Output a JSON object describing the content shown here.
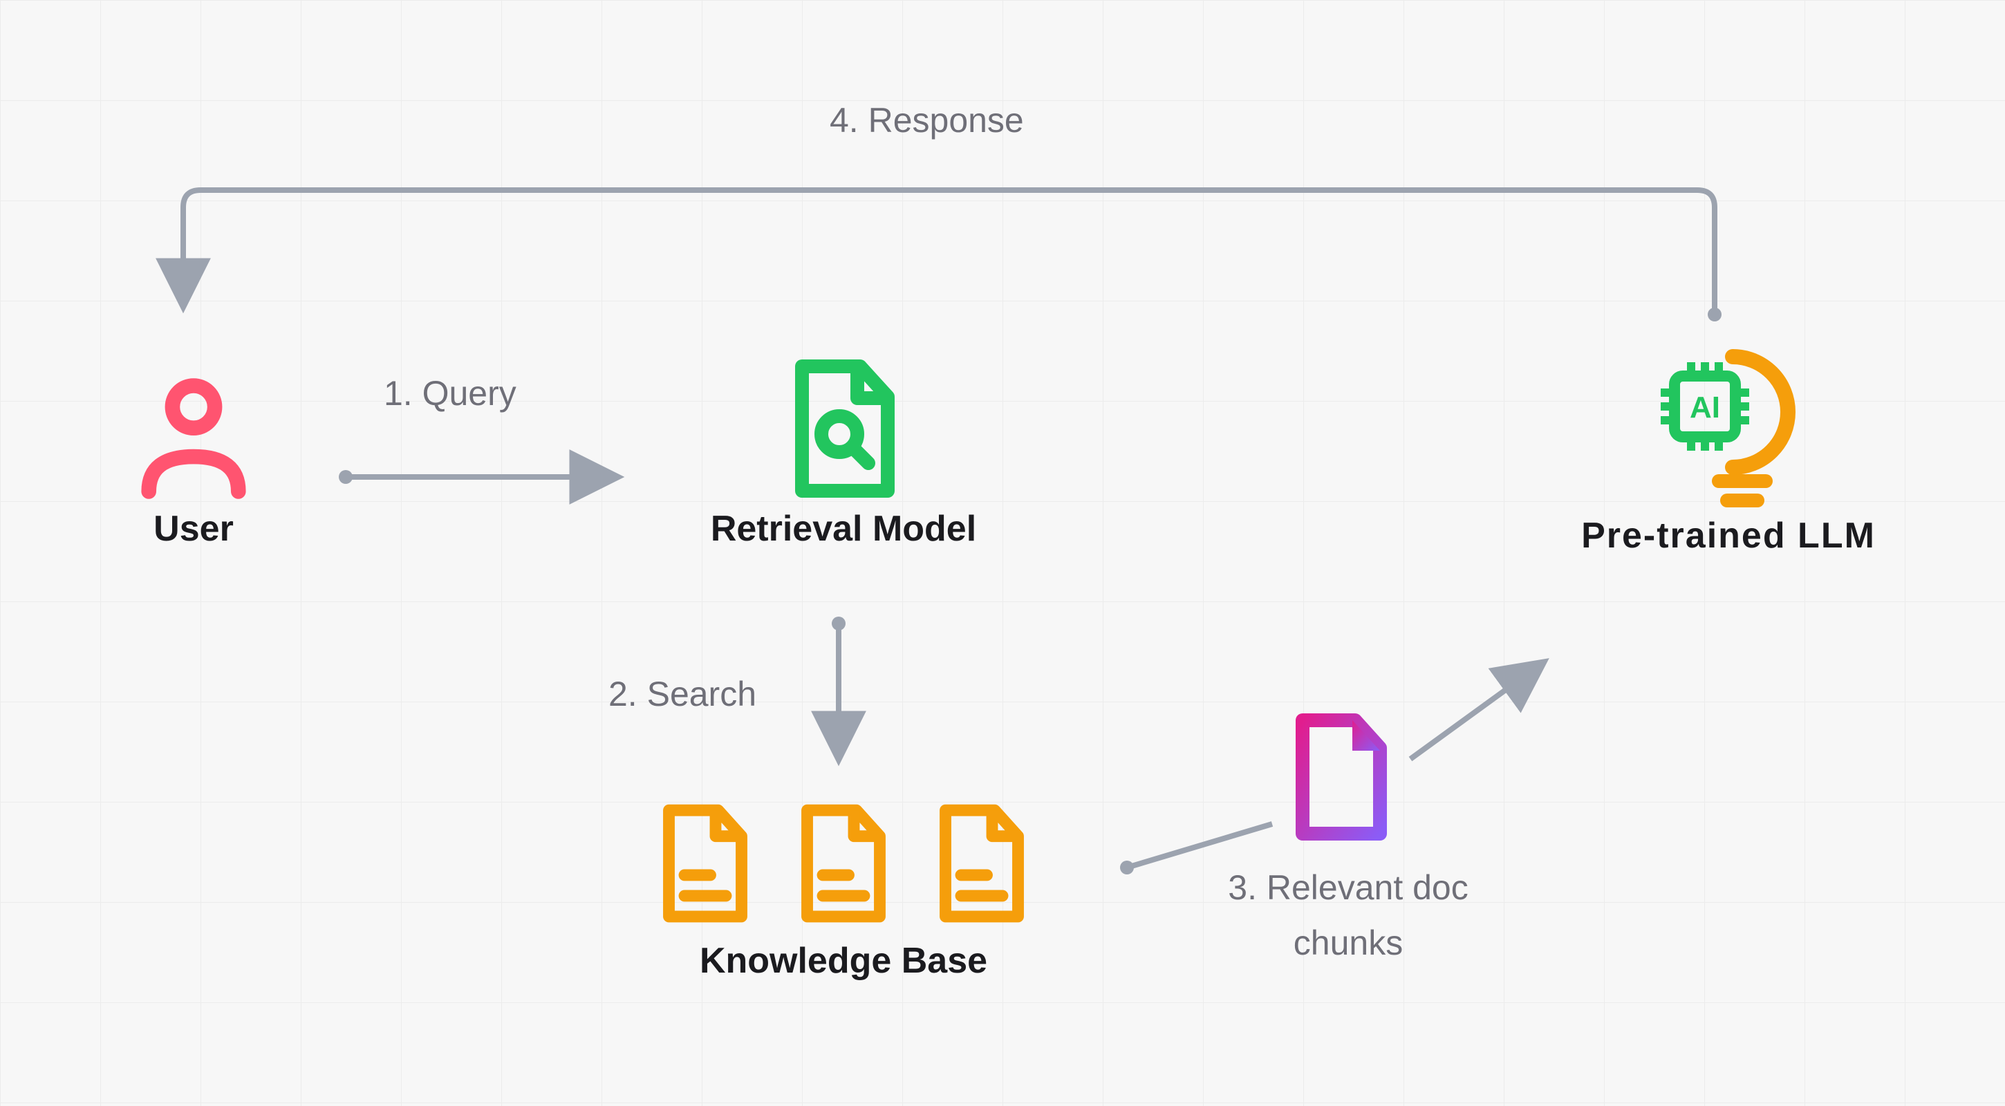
{
  "nodes": {
    "user": {
      "label": "User"
    },
    "retrieval": {
      "label": "Retrieval Model"
    },
    "llm": {
      "label": "Pre-trained  LLM"
    },
    "kb": {
      "label": "Knowledge Base"
    }
  },
  "edges": {
    "query": {
      "label": "1. Query"
    },
    "search": {
      "label": "2. Search"
    },
    "chunks_l1": {
      "label": "3. Relevant doc"
    },
    "chunks_l2": {
      "label": "chunks"
    },
    "response": {
      "label": "4. Response"
    }
  },
  "icons": {
    "ai_chip_text": "AI"
  },
  "colors": {
    "user": "#ff5470",
    "retrieval": "#22c55e",
    "llm_bulb": "#f59e0b",
    "llm_chip": "#22c55e",
    "kb_doc": "#f59e0b",
    "chunk_doc_a": "#e11d8e",
    "chunk_doc_b": "#8b5cf6",
    "arrow": "#9ca3af",
    "text_muted": "#6f6f78",
    "text": "#1b1b1f"
  }
}
